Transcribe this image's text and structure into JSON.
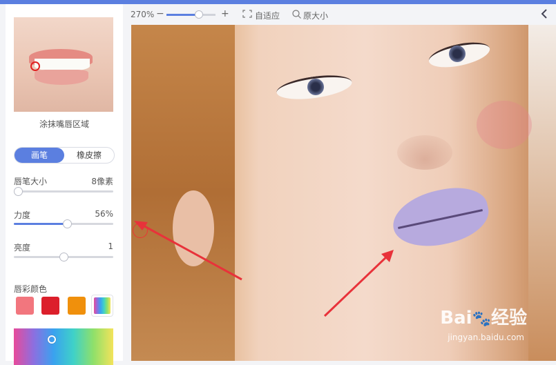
{
  "panel": {
    "caption": "涂抹嘴唇区域",
    "modes": {
      "brush": "画笔",
      "eraser": "橡皮擦"
    },
    "brush_size": {
      "label": "唇笔大小",
      "value": "8像素",
      "level": 0.0
    },
    "strength": {
      "label": "力度",
      "value": "56%",
      "level": 0.56
    },
    "brightness": {
      "label": "亮度",
      "value": "1",
      "level": 0.5
    },
    "color_section_label": "唇彩颜色",
    "swatches": [
      "#f2767e",
      "#dc1f2b",
      "#f0900c",
      "rainbow"
    ]
  },
  "toolbar": {
    "zoom_value": "270%",
    "zoom_minus": "−",
    "zoom_plus": "+",
    "fit_label": "自适应",
    "original_label": "原大小",
    "back_icon": "chevron-left-icon"
  },
  "watermark": {
    "brand": "Bai",
    "suffix": "经验",
    "url": "jingyan.baidu.com"
  },
  "colors": {
    "accent": "#5b7fe0",
    "lip_color": "#b7aade",
    "arrow": "#e8323a"
  }
}
